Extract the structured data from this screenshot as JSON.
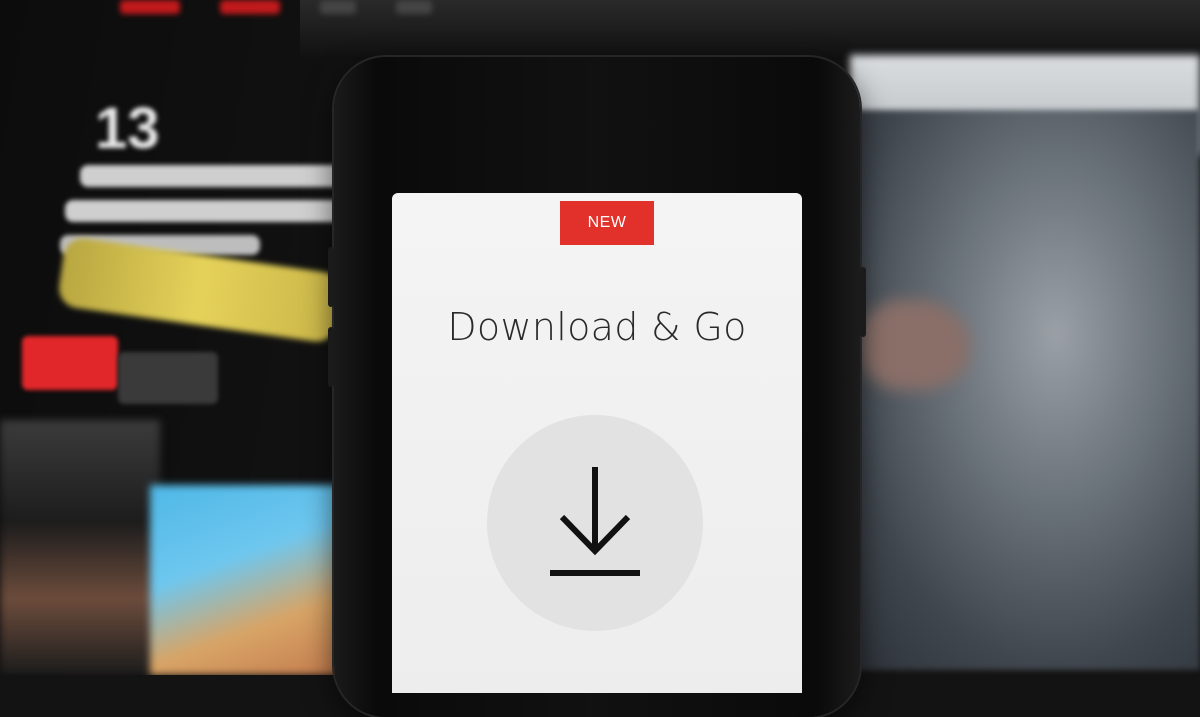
{
  "phone_app": {
    "badge": "NEW",
    "heading": "Download & Go",
    "icon": "download-icon",
    "accent_color": "#e2302a"
  },
  "background": {
    "count_text": "13"
  }
}
